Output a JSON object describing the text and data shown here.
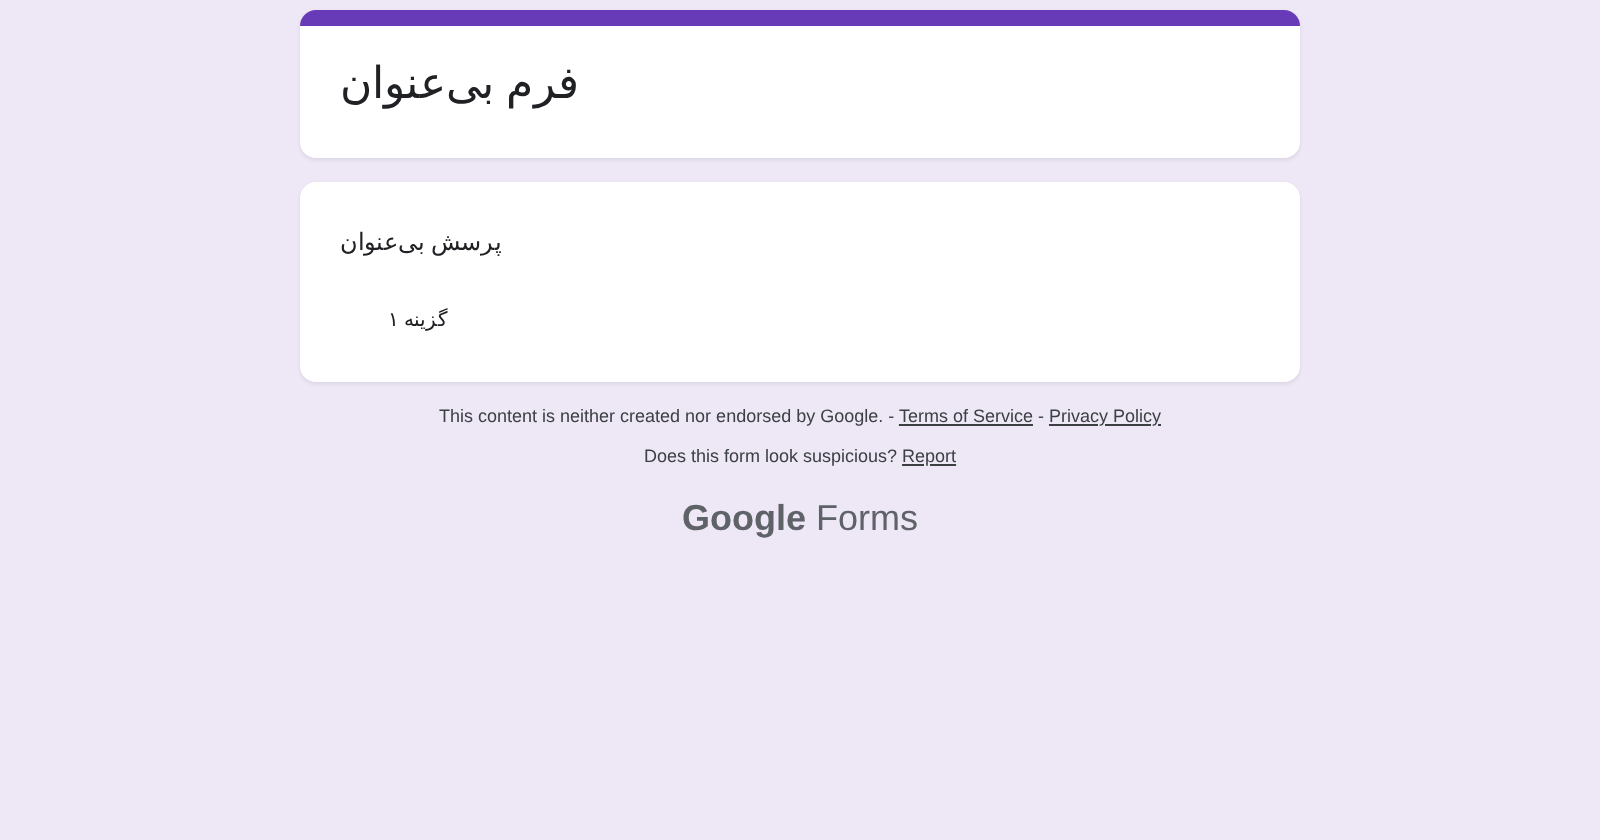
{
  "form": {
    "title": "فرم بی‌عنوان"
  },
  "questions": [
    {
      "title": "پرسش بی‌عنوان",
      "options": [
        "گزینه ۱"
      ]
    }
  ],
  "footer": {
    "disclaimer": "This content is neither created nor endorsed by Google.",
    "separator": "-",
    "links": [
      "Terms of Service",
      "Privacy Policy"
    ],
    "report_prompt": "Does this form look suspicious?",
    "report_link": "Report"
  },
  "logo": {
    "brand": "Google",
    "product": "Forms"
  }
}
